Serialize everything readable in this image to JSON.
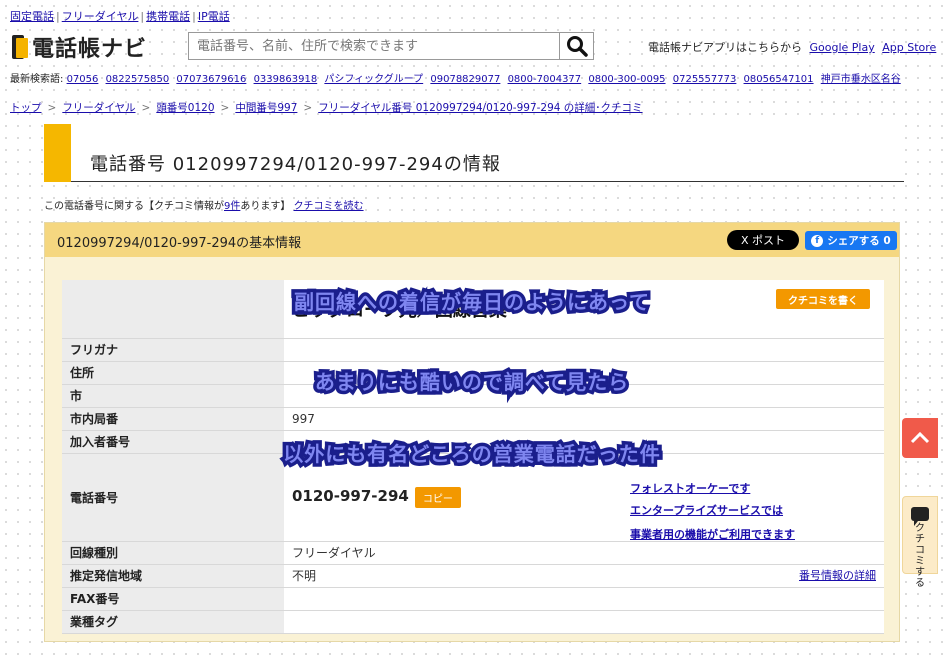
{
  "topnav": {
    "items": [
      "固定電話",
      "フリーダイヤル",
      "携帯電話",
      "IP電話"
    ]
  },
  "header": {
    "logo_text": "電話帳ナビ",
    "search_placeholder": "電話番号、名前、住所で検索できます",
    "app_text": "電話帳ナビアプリはこちらから",
    "google_play": "Google Play",
    "app_store": "App Store"
  },
  "recent": {
    "label": "最新検索語:",
    "items": [
      "07056",
      "0822575850",
      "07073679616",
      "0339863918",
      "パシフィックグループ",
      "09078829077",
      "0800-7004377",
      "0800-300-0095",
      "0725557773",
      "08056547101",
      "神戸市垂水区名谷"
    ]
  },
  "breadcrumb": {
    "items": [
      "トップ",
      "フリーダイヤル",
      "頭番号0120",
      "中間番号997",
      "フリーダイヤル番号 0120997294/0120-997-294 の詳細･クチコミ"
    ]
  },
  "page": {
    "title": "電話番号 0120997294/0120-997-294の情報",
    "review_note_pre": "この電話番号に関する【クチコミ情報が",
    "review_count_link": "9件",
    "review_note_post": "あります】",
    "read_reviews_link": "クチコミを読む"
  },
  "panel": {
    "title": "0120997294/0120-997-294の基本情報",
    "post_button": "X ポスト",
    "share_button": "シェアする 0",
    "review_button": "クチコミを書く"
  },
  "info": {
    "company_value": "ビッグローブ光／回線営業",
    "furigana_label": "フリガナ",
    "address_label": "住所",
    "city_label": "市",
    "exchange_label": "市内局番",
    "exchange_value": "997",
    "subscriber_label": "加入者番号",
    "phone_label": "電話番号",
    "phone_value": "0120-997-294",
    "phone_tag": "コピー",
    "enterprise_link1": "フォレストオーケーです",
    "enterprise_link2": "エンタープライズサービスでは",
    "enterprise_link3": "事業者用の機能がご利用できます",
    "line_type_label": "回線種別",
    "line_type_value": "フリーダイヤル",
    "origin_label": "推定発信地域",
    "origin_value": "不明",
    "detail_link": "番号情報の詳細",
    "fax_label": "FAX番号",
    "industry_label": "業種タグ"
  },
  "overlay": {
    "line1": "副回線への着信が毎日のようにあって",
    "line2": "あまりにも酷いので調べて見たら",
    "line3": "以外にも有名どころの営業電話だった件"
  },
  "floating": {
    "review_text": "クチコミする"
  },
  "colors": {
    "accent_yellow": "#f5b700",
    "panel_bg": "#faf2d5",
    "overlay_fill": "#7f86f0",
    "overlay_stroke": "#1b1f8c",
    "link": "#1a0dab",
    "orange": "#f39800"
  }
}
